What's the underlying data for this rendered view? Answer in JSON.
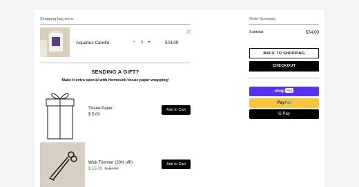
{
  "cart": {
    "title": "Shopping bag items",
    "item": {
      "name": "Aquarius Candle",
      "qty_minus": "-",
      "qty": "1",
      "qty_plus": "+",
      "price": "$34.00",
      "remove_icon": "close-icon"
    }
  },
  "gift": {
    "heading": "SENDING A GIFT?",
    "subheading": "Make it extra special with Homesick tissue paper wrapping!",
    "icon": "gift-box-icon",
    "tissue": {
      "name": "Tissue Paper",
      "price": "$ 5.00",
      "button": "Add to Cart"
    },
    "wick": {
      "name": "Wick Trimmer (20% off!)",
      "sale_price": "$ 15.00",
      "original_price": "$ 19.00",
      "button": "Add to Cart"
    }
  },
  "summary": {
    "title": "Order Summary",
    "subtotal_label": "Subtotal",
    "subtotal_value": "$34.00",
    "back_button": "BACK TO SHOPPING",
    "checkout_button": "CHECKOUT",
    "shop_pay_text": "shop",
    "shop_pay_badge": "Pay",
    "paypal_pay": "Pay",
    "paypal_pal": "Pal",
    "gpay_text": "G Pay"
  },
  "colors": {
    "shop_pay": "#5a31f4",
    "paypal": "#ffc439",
    "sale_green": "#2f9e44"
  }
}
